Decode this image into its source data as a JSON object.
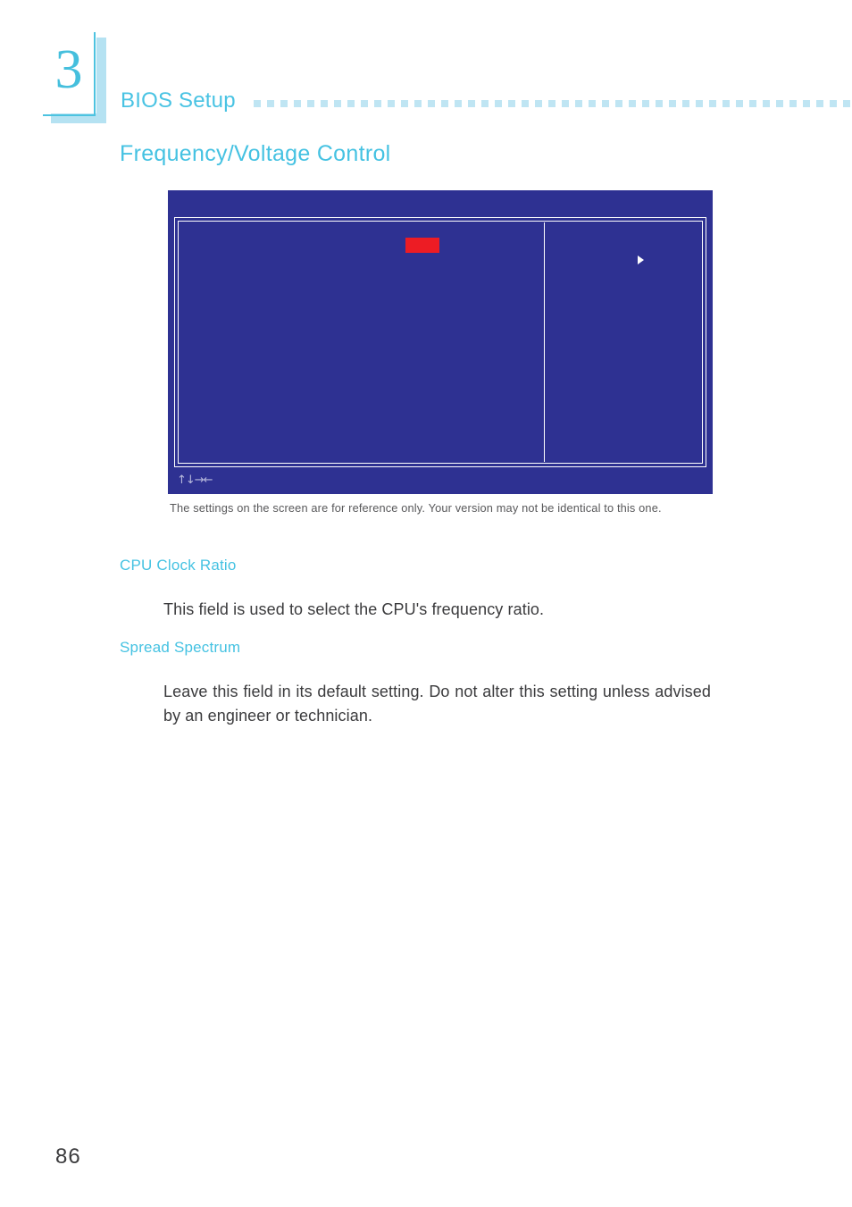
{
  "chapter": {
    "number": "3",
    "running_head": "BIOS Setup",
    "dot_count": 46,
    "accent_color": "#45c2e2",
    "dot_color": "#bfe5f3",
    "shadow_color": "#b5e2f2"
  },
  "section": {
    "heading": "Frequency/Voltage  Control"
  },
  "bios_screen": {
    "background_color": "#2e3192",
    "border_color": "#ffffff",
    "highlight_color": "#ed1c24",
    "navigation_keys": "↑↓→←",
    "pointer_icon": "right-triangle-icon",
    "left_pane_label": "",
    "right_pane_label": ""
  },
  "caption": {
    "text": "The settings on the screen are for reference only. Your version may not be identical to this one."
  },
  "fields": [
    {
      "heading": "CPU Clock Ratio",
      "body": "This field is used to select the CPU's frequency ratio."
    },
    {
      "heading": "Spread Spectrum",
      "body": "Leave this field in its default setting. Do not alter this setting unless advised by an engineer or technician."
    }
  ],
  "footer": {
    "page_number": "86"
  }
}
